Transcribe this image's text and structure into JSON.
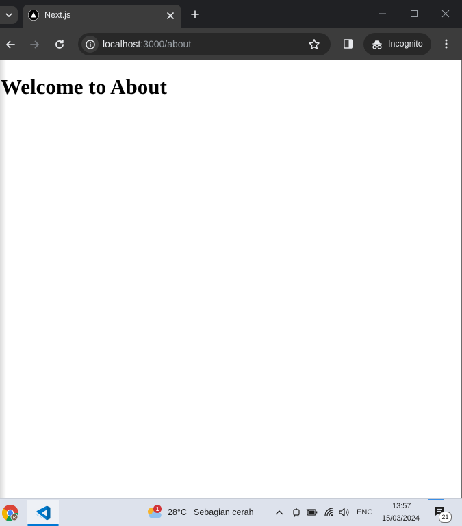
{
  "browser": {
    "tab": {
      "title": "Next.js",
      "favicon": "nextjs-logo-icon"
    },
    "address_bar": {
      "host": "localhost",
      "path": ":3000/about"
    },
    "incognito_label": "Incognito"
  },
  "page": {
    "heading": "Welcome to About"
  },
  "taskbar": {
    "apps": [
      "chrome-icon",
      "vscode-icon"
    ],
    "weather": {
      "badge": "1",
      "temperature": "28°C",
      "description": "Sebagian cerah"
    },
    "language": "ENG",
    "time": "13:57",
    "date": "15/03/2024",
    "notification_count": "21"
  },
  "colors": {
    "tabstrip_bg": "#202124",
    "toolbar_bg": "#3c3c3c",
    "omnibox_bg": "#282828",
    "taskbar_bg": "#dde2ec",
    "accent": "#0078d4"
  }
}
